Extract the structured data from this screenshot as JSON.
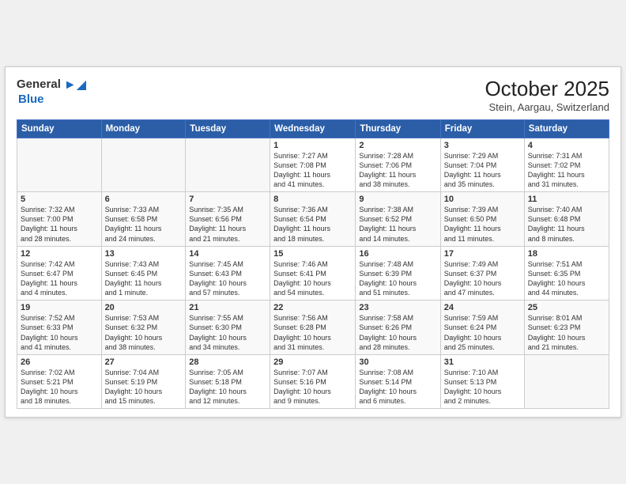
{
  "header": {
    "logo_general": "General",
    "logo_blue": "Blue",
    "month_title": "October 2025",
    "location": "Stein, Aargau, Switzerland"
  },
  "weekdays": [
    "Sunday",
    "Monday",
    "Tuesday",
    "Wednesday",
    "Thursday",
    "Friday",
    "Saturday"
  ],
  "weeks": [
    [
      {
        "day": "",
        "info": ""
      },
      {
        "day": "",
        "info": ""
      },
      {
        "day": "",
        "info": ""
      },
      {
        "day": "1",
        "info": "Sunrise: 7:27 AM\nSunset: 7:08 PM\nDaylight: 11 hours\nand 41 minutes."
      },
      {
        "day": "2",
        "info": "Sunrise: 7:28 AM\nSunset: 7:06 PM\nDaylight: 11 hours\nand 38 minutes."
      },
      {
        "day": "3",
        "info": "Sunrise: 7:29 AM\nSunset: 7:04 PM\nDaylight: 11 hours\nand 35 minutes."
      },
      {
        "day": "4",
        "info": "Sunrise: 7:31 AM\nSunset: 7:02 PM\nDaylight: 11 hours\nand 31 minutes."
      }
    ],
    [
      {
        "day": "5",
        "info": "Sunrise: 7:32 AM\nSunset: 7:00 PM\nDaylight: 11 hours\nand 28 minutes."
      },
      {
        "day": "6",
        "info": "Sunrise: 7:33 AM\nSunset: 6:58 PM\nDaylight: 11 hours\nand 24 minutes."
      },
      {
        "day": "7",
        "info": "Sunrise: 7:35 AM\nSunset: 6:56 PM\nDaylight: 11 hours\nand 21 minutes."
      },
      {
        "day": "8",
        "info": "Sunrise: 7:36 AM\nSunset: 6:54 PM\nDaylight: 11 hours\nand 18 minutes."
      },
      {
        "day": "9",
        "info": "Sunrise: 7:38 AM\nSunset: 6:52 PM\nDaylight: 11 hours\nand 14 minutes."
      },
      {
        "day": "10",
        "info": "Sunrise: 7:39 AM\nSunset: 6:50 PM\nDaylight: 11 hours\nand 11 minutes."
      },
      {
        "day": "11",
        "info": "Sunrise: 7:40 AM\nSunset: 6:48 PM\nDaylight: 11 hours\nand 8 minutes."
      }
    ],
    [
      {
        "day": "12",
        "info": "Sunrise: 7:42 AM\nSunset: 6:47 PM\nDaylight: 11 hours\nand 4 minutes."
      },
      {
        "day": "13",
        "info": "Sunrise: 7:43 AM\nSunset: 6:45 PM\nDaylight: 11 hours\nand 1 minute."
      },
      {
        "day": "14",
        "info": "Sunrise: 7:45 AM\nSunset: 6:43 PM\nDaylight: 10 hours\nand 57 minutes."
      },
      {
        "day": "15",
        "info": "Sunrise: 7:46 AM\nSunset: 6:41 PM\nDaylight: 10 hours\nand 54 minutes."
      },
      {
        "day": "16",
        "info": "Sunrise: 7:48 AM\nSunset: 6:39 PM\nDaylight: 10 hours\nand 51 minutes."
      },
      {
        "day": "17",
        "info": "Sunrise: 7:49 AM\nSunset: 6:37 PM\nDaylight: 10 hours\nand 47 minutes."
      },
      {
        "day": "18",
        "info": "Sunrise: 7:51 AM\nSunset: 6:35 PM\nDaylight: 10 hours\nand 44 minutes."
      }
    ],
    [
      {
        "day": "19",
        "info": "Sunrise: 7:52 AM\nSunset: 6:33 PM\nDaylight: 10 hours\nand 41 minutes."
      },
      {
        "day": "20",
        "info": "Sunrise: 7:53 AM\nSunset: 6:32 PM\nDaylight: 10 hours\nand 38 minutes."
      },
      {
        "day": "21",
        "info": "Sunrise: 7:55 AM\nSunset: 6:30 PM\nDaylight: 10 hours\nand 34 minutes."
      },
      {
        "day": "22",
        "info": "Sunrise: 7:56 AM\nSunset: 6:28 PM\nDaylight: 10 hours\nand 31 minutes."
      },
      {
        "day": "23",
        "info": "Sunrise: 7:58 AM\nSunset: 6:26 PM\nDaylight: 10 hours\nand 28 minutes."
      },
      {
        "day": "24",
        "info": "Sunrise: 7:59 AM\nSunset: 6:24 PM\nDaylight: 10 hours\nand 25 minutes."
      },
      {
        "day": "25",
        "info": "Sunrise: 8:01 AM\nSunset: 6:23 PM\nDaylight: 10 hours\nand 21 minutes."
      }
    ],
    [
      {
        "day": "26",
        "info": "Sunrise: 7:02 AM\nSunset: 5:21 PM\nDaylight: 10 hours\nand 18 minutes."
      },
      {
        "day": "27",
        "info": "Sunrise: 7:04 AM\nSunset: 5:19 PM\nDaylight: 10 hours\nand 15 minutes."
      },
      {
        "day": "28",
        "info": "Sunrise: 7:05 AM\nSunset: 5:18 PM\nDaylight: 10 hours\nand 12 minutes."
      },
      {
        "day": "29",
        "info": "Sunrise: 7:07 AM\nSunset: 5:16 PM\nDaylight: 10 hours\nand 9 minutes."
      },
      {
        "day": "30",
        "info": "Sunrise: 7:08 AM\nSunset: 5:14 PM\nDaylight: 10 hours\nand 6 minutes."
      },
      {
        "day": "31",
        "info": "Sunrise: 7:10 AM\nSunset: 5:13 PM\nDaylight: 10 hours\nand 2 minutes."
      },
      {
        "day": "",
        "info": ""
      }
    ]
  ]
}
